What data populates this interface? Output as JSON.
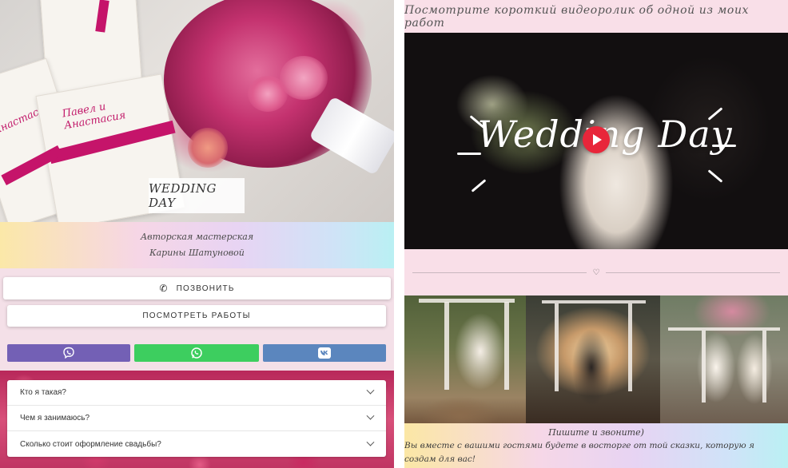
{
  "left": {
    "hero": {
      "badge_text": "WEDDING DAY",
      "invitation_top_text": "Павел и Анастасия",
      "invitation_left_text": "Анастасия"
    },
    "studio": {
      "line1": "Авторская мастерская",
      "line2": "Карины Шатуновой"
    },
    "actions": {
      "call_label": "позвонить",
      "works_label": "посмотреть работы",
      "call_icon": "phone-icon",
      "socials": [
        {
          "name": "viber",
          "icon": "viber-icon",
          "color": "#7360b5"
        },
        {
          "name": "whatsapp",
          "icon": "whatsapp-icon",
          "color": "#3dce5f"
        },
        {
          "name": "vk",
          "icon": "vk-icon",
          "color": "#5b86be"
        }
      ]
    },
    "faq": [
      {
        "question": "Кто я такая?"
      },
      {
        "question": "Чем я занимаюсь?"
      },
      {
        "question": "Сколько стоит оформление свадьбы?"
      }
    ]
  },
  "right": {
    "video_heading": "Посмотрите короткий видеоролик об одной из моих работ",
    "video": {
      "overlay_title": "Wedding Day",
      "play_icon": "play-icon",
      "play_color": "#e8263a"
    },
    "divider_icon": "heart-icon",
    "contact": {
      "title": "Пишите и звоните)",
      "body": "Вы вместе с вашими гостями будете в восторге от той сказки, которую я создам для вас!"
    }
  },
  "colors": {
    "accent_pink": "#c5146a",
    "panel_bg": "#f4e0e8"
  }
}
